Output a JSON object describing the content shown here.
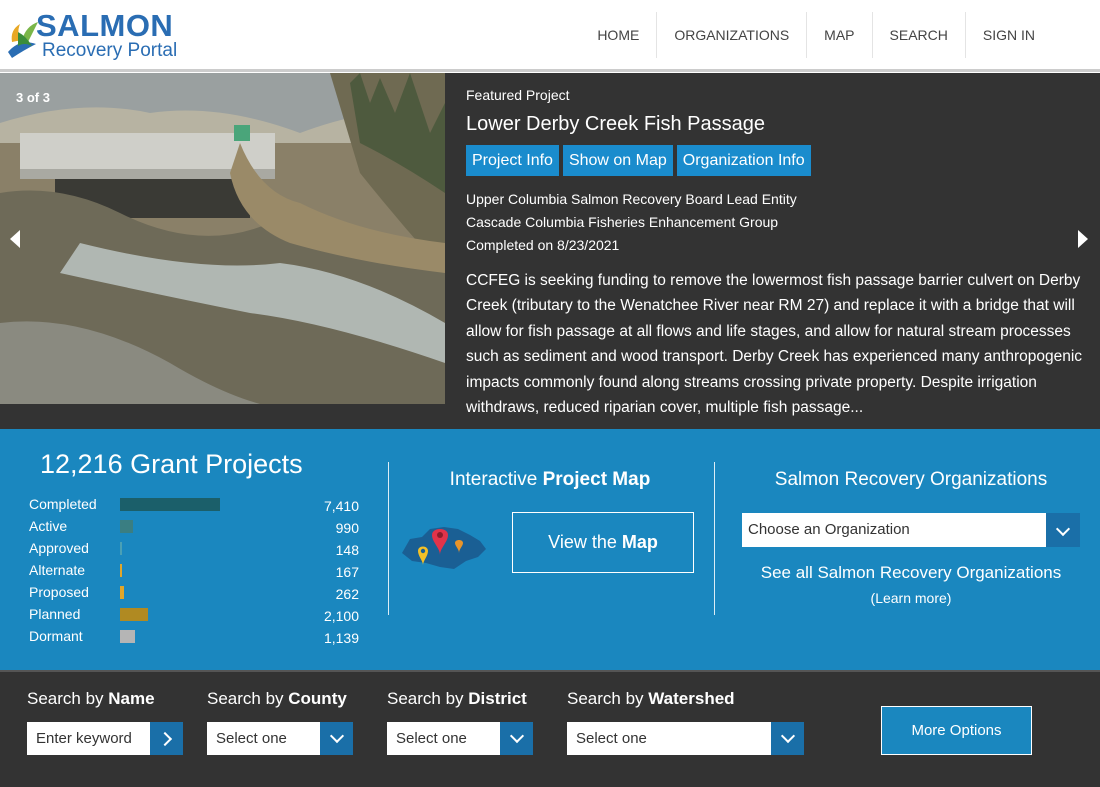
{
  "logo": {
    "line1": "SALMON",
    "line2": "Recovery Portal"
  },
  "nav": [
    "HOME",
    "ORGANIZATIONS",
    "MAP",
    "SEARCH",
    "SIGN IN"
  ],
  "hero": {
    "slide_counter": "3  of  3",
    "featured_label": "Featured Project",
    "title": "Lower Derby Creek Fish Passage",
    "buttons": [
      "Project Info",
      "Show on Map",
      "Organization Info"
    ],
    "lead_entity": "Upper Columbia Salmon Recovery Board Lead Entity",
    "sponsor": "Cascade Columbia Fisheries Enhancement Group",
    "completed": "Completed on 8/23/2021",
    "description": "CCFEG is seeking funding to remove the lowermost fish passage barrier culvert on Derby Creek (tributary to the Wenatchee River near RM 27) and replace it with a bridge that will allow for fish passage at all flows and life stages, and allow for natural stream processes such as sediment and wood transport. Derby Creek has experienced many anthropogenic impacts commonly found along streams crossing private property. Despite irrigation withdraws, reduced riparian cover, multiple fish passage..."
  },
  "stats": {
    "title": "12,216 Grant Projects",
    "rows": [
      {
        "label": "Completed",
        "value": "7,410",
        "count": 7410,
        "color": "#1b5f6a"
      },
      {
        "label": "Active",
        "value": "990",
        "count": 990,
        "color": "#3a7e82"
      },
      {
        "label": "Approved",
        "value": "148",
        "count": 148,
        "color": "#4aa0b5"
      },
      {
        "label": "Alternate",
        "value": "167",
        "count": 167,
        "color": "#e0a62a"
      },
      {
        "label": "Proposed",
        "value": "262",
        "count": 262,
        "color": "#e0a62a"
      },
      {
        "label": "Planned",
        "value": "2,100",
        "count": 2100,
        "color": "#b08a22"
      },
      {
        "label": "Dormant",
        "value": "1,139",
        "count": 1139,
        "color": "#b5b5b5"
      }
    ]
  },
  "map_section": {
    "title_plain": "Interactive ",
    "title_bold": "Project Map",
    "button_plain": "View the ",
    "button_bold": "Map"
  },
  "org_section": {
    "title": "Salmon Recovery Organizations",
    "select_value": "Choose an Organization",
    "see_all": "See all Salmon Recovery Organizations",
    "learn_more": "(Learn more)"
  },
  "search": {
    "name": {
      "plain": "Search by ",
      "bold": "Name",
      "placeholder": "Enter keyword"
    },
    "county": {
      "plain": "Search by ",
      "bold": "County",
      "value": "Select one"
    },
    "district": {
      "plain": "Search by ",
      "bold": "District",
      "value": "Select one"
    },
    "watershed": {
      "plain": "Search by ",
      "bold": "Watershed",
      "value": "Select one"
    },
    "more_options": "More Options"
  }
}
